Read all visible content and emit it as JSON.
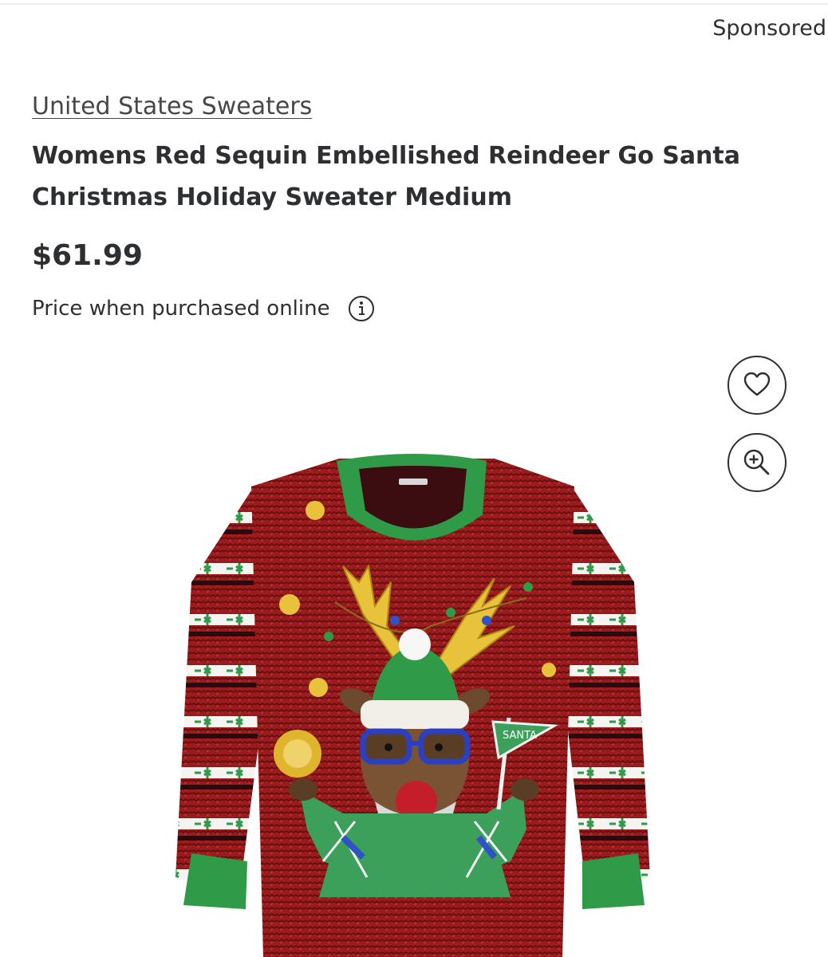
{
  "header": {
    "sponsored_label": "Sponsored"
  },
  "product": {
    "brand": "United States Sweaters",
    "title": "Womens Red Sequin Embellished Reindeer Go Santa Christmas Holiday Sweater Medium",
    "price": "$61.99",
    "price_note": "Price when purchased online",
    "image_flag_text": "SANTA"
  },
  "icons": {
    "info": "info-icon",
    "favorite": "heart-icon",
    "zoom": "zoom-in-icon"
  },
  "colors": {
    "text": "#2e2f32",
    "sweater_red": "#9b1c1c",
    "sweater_green": "#2f9a48",
    "antler_gold": "#e8c23a"
  }
}
